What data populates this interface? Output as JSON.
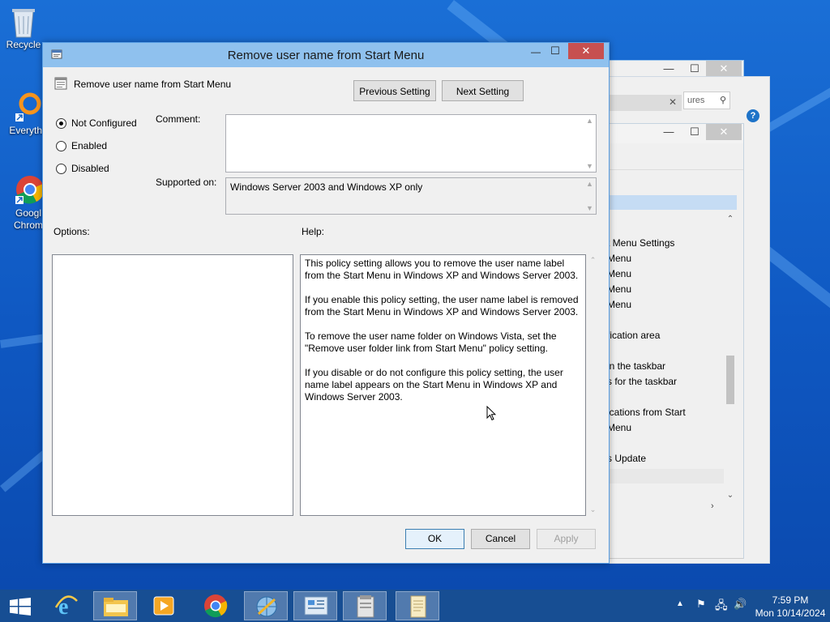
{
  "desktop": {
    "icons": [
      {
        "label": "Recycle",
        "icon": "recycle-bin-icon"
      },
      {
        "label": "Everythi",
        "icon": "everything-search-icon"
      },
      {
        "label": "Googl Chrom",
        "icon": "chrome-icon"
      }
    ]
  },
  "background_window": {
    "search_placeholder": "ures",
    "list_items": [
      "t Menu Settings",
      "Menu",
      "Menu",
      "Menu",
      "Menu",
      "fication area",
      "in the taskbar",
      "s for the taskbar",
      "ications from Start",
      "Menu",
      "s Update"
    ]
  },
  "dialog": {
    "title": "Remove user name from Start Menu",
    "policy_name": "Remove user name from Start Menu",
    "previous_setting": "Previous Setting",
    "next_setting": "Next Setting",
    "radios": {
      "not_configured": "Not Configured",
      "enabled": "Enabled",
      "disabled": "Disabled",
      "selected": "Not Configured"
    },
    "comment_label": "Comment:",
    "comment_value": "",
    "supported_label": "Supported on:",
    "supported_value": "Windows Server 2003 and Windows XP only",
    "options_label": "Options:",
    "help_label": "Help:",
    "help_paragraphs": [
      "This policy setting allows you to remove the user name label from the Start Menu in Windows XP and Windows Server 2003.",
      "If you enable this policy setting, the user name label is removed from the Start Menu in Windows XP and Windows Server 2003.",
      "To remove the user name folder on Windows Vista, set the \"Remove user folder link from Start Menu\" policy setting.",
      "If you disable or do not configure this policy setting, the user name label appears on the Start Menu in Windows XP and Windows Server 2003."
    ],
    "ok": "OK",
    "cancel": "Cancel",
    "apply": "Apply"
  },
  "taskbar": {
    "items": [
      "start-icon",
      "internet-explorer-icon",
      "file-explorer-icon",
      "media-player-icon",
      "chrome-icon",
      "network-icon",
      "control-panel-icon",
      "notes-icon",
      "notepad-icon"
    ],
    "time": "7:59 PM",
    "date": "Mon 10/14/2024"
  },
  "colors": {
    "accent": "#8fc1ee",
    "close_button": "#c75050",
    "taskbar": "#174e93",
    "desktop": "#1565c8"
  }
}
